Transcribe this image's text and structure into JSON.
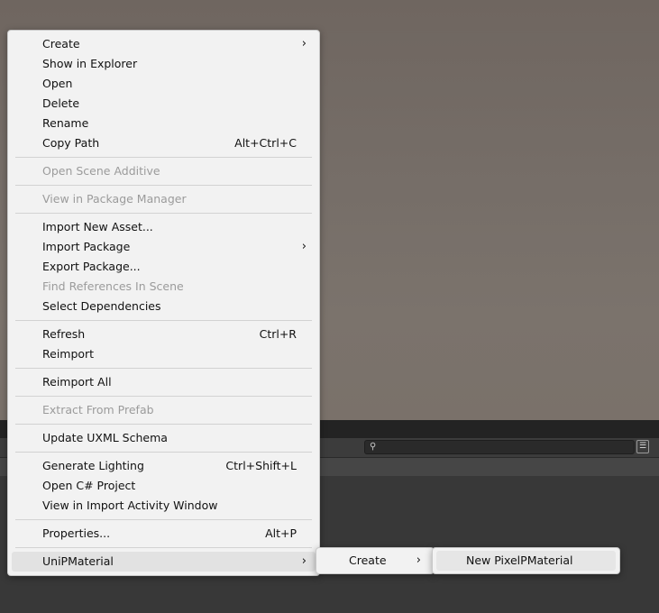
{
  "search": {
    "icon": "search-icon"
  },
  "context_menu": {
    "groups": [
      [
        {
          "label": "Create",
          "submenu": true
        },
        {
          "label": "Show in Explorer"
        },
        {
          "label": "Open"
        },
        {
          "label": "Delete"
        },
        {
          "label": "Rename"
        },
        {
          "label": "Copy Path",
          "shortcut": "Alt+Ctrl+C"
        }
      ],
      [
        {
          "label": "Open Scene Additive",
          "disabled": true
        }
      ],
      [
        {
          "label": "View in Package Manager",
          "disabled": true
        }
      ],
      [
        {
          "label": "Import New Asset..."
        },
        {
          "label": "Import Package",
          "submenu": true
        },
        {
          "label": "Export Package..."
        },
        {
          "label": "Find References In Scene",
          "disabled": true
        },
        {
          "label": "Select Dependencies"
        }
      ],
      [
        {
          "label": "Refresh",
          "shortcut": "Ctrl+R"
        },
        {
          "label": "Reimport"
        }
      ],
      [
        {
          "label": "Reimport All"
        }
      ],
      [
        {
          "label": "Extract From Prefab",
          "disabled": true
        }
      ],
      [
        {
          "label": "Update UXML Schema"
        }
      ],
      [
        {
          "label": "Generate Lighting",
          "shortcut": "Ctrl+Shift+L"
        },
        {
          "label": "Open C# Project"
        },
        {
          "label": "View in Import Activity Window"
        }
      ],
      [
        {
          "label": "Properties...",
          "shortcut": "Alt+P"
        }
      ],
      [
        {
          "label": "UniPMaterial",
          "submenu": true,
          "active": true
        }
      ]
    ]
  },
  "submenu_1": {
    "items": [
      {
        "label": "Create",
        "submenu": true
      }
    ]
  },
  "submenu_2": {
    "items": [
      {
        "label": "New PixelPMaterial"
      }
    ]
  },
  "colors": {
    "menu_bg": "#f2f2f2",
    "disabled_text": "#9b9b9b",
    "highlight": "#e2e2e2"
  }
}
